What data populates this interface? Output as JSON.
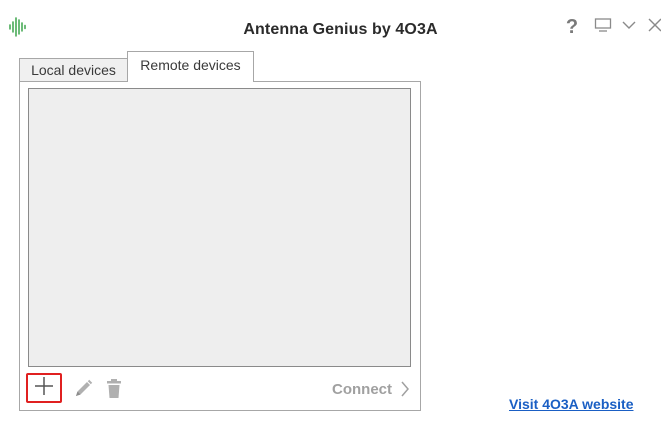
{
  "window": {
    "title": "Antenna Genius by 4O3A",
    "app_icon": "waveform-icon",
    "controls": {
      "help_label": "?",
      "display_icon": "monitor-icon",
      "minimize_icon": "chevron-down-icon",
      "close_icon": "close-icon"
    }
  },
  "tabs": [
    {
      "label": "Local devices",
      "selected": false
    },
    {
      "label": "Remote devices",
      "selected": true
    }
  ],
  "device_list": {
    "items": []
  },
  "toolbar": {
    "add_icon": "plus-icon",
    "edit_icon": "pencil-icon",
    "delete_icon": "trash-icon",
    "connect_label": "Connect",
    "connect_icon": "chevron-right-icon"
  },
  "footer": {
    "link_label": "Visit 4O3A website"
  },
  "colors": {
    "accent_icon": "#2e9e3e",
    "link": "#1a5fc4",
    "highlight": "#e02020",
    "disabled": "#a0a0a0"
  }
}
